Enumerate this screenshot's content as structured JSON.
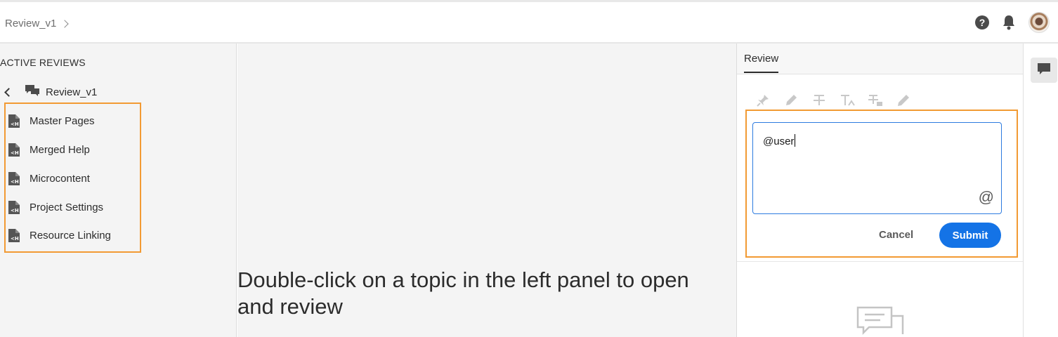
{
  "header": {
    "breadcrumb": "Review_v1",
    "help_icon": "help-icon",
    "bell_icon": "bell-icon",
    "avatar_icon": "user-avatar"
  },
  "left_panel": {
    "title": "ACTIVE REVIEWS",
    "review_name": "Review_v1",
    "topics": [
      {
        "label": "Master Pages"
      },
      {
        "label": "Merged Help"
      },
      {
        "label": "Microcontent"
      },
      {
        "label": "Project Settings"
      },
      {
        "label": "Resource Linking"
      }
    ]
  },
  "center": {
    "message": "Double-click on a topic in the left panel to open and review"
  },
  "review_panel": {
    "tab": "Review",
    "tools": [
      "pin-icon",
      "highlight-icon",
      "strikethrough-icon",
      "insert-text-icon",
      "replace-text-icon",
      "pencil-icon"
    ],
    "comment_value": "@user",
    "at_symbol": "@",
    "cancel_label": "Cancel",
    "submit_label": "Submit"
  },
  "colors": {
    "accent": "#1473e6",
    "highlight_border": "#f29a33"
  }
}
